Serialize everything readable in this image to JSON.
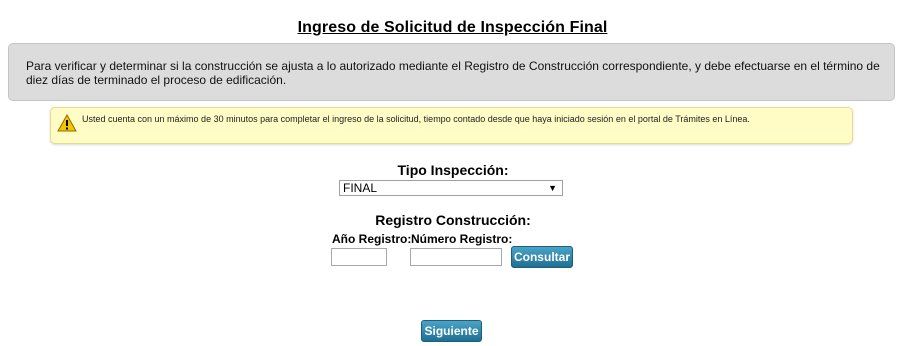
{
  "page": {
    "title": "Ingreso de Solicitud de Inspección Final"
  },
  "info": {
    "text": "Para verificar y determinar si la construcción se ajusta a lo autorizado mediante el Registro de Construcción correspondiente, y debe efectuarse en el término de diez días de terminado el proceso de edificación."
  },
  "warning": {
    "icon": "warning-icon",
    "text": "Usted cuenta con un máximo de 30 minutos para completar el ingreso de la solicitud, tiempo contado desde que haya iniciado sesión en el portal de Trámites en Línea."
  },
  "form": {
    "tipo_label": "Tipo Inspección:",
    "tipo_value": "FINAL",
    "registro_label": "Registro Construcción:",
    "anio_label": "Año Registro:",
    "numero_label": "Número Registro:",
    "anio_value": "",
    "numero_value": "",
    "consultar_label": "Consultar",
    "siguiente_label": "Siguiente"
  },
  "colors": {
    "info_bg": "#dcdcdc",
    "warning_bg": "#fffcc6",
    "button_top": "#4aa3c6",
    "button_bottom": "#1f6f93"
  }
}
